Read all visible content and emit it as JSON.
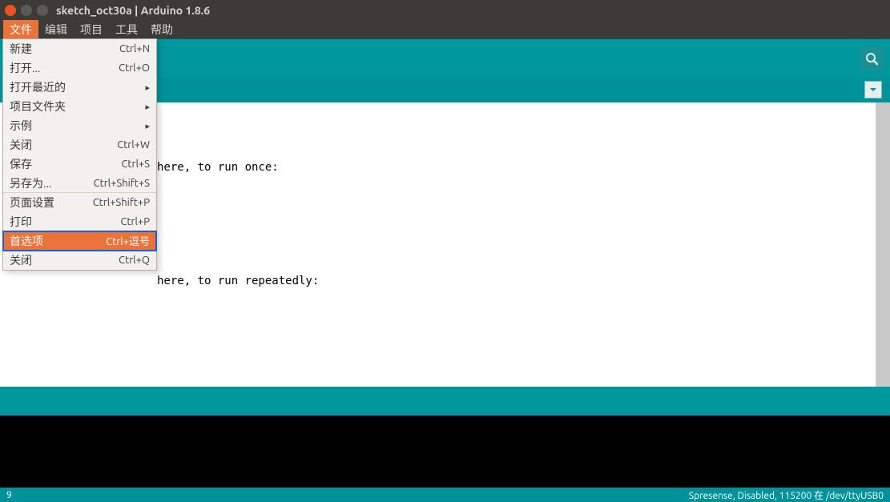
{
  "window": {
    "title": "sketch_oct30a | Arduino 1.8.6"
  },
  "menubar": {
    "items": [
      {
        "label": "文件",
        "active": true
      },
      {
        "label": "编辑"
      },
      {
        "label": "项目"
      },
      {
        "label": "工具"
      },
      {
        "label": "帮助"
      }
    ]
  },
  "dropdown": {
    "items": [
      {
        "label": "新建",
        "shortcut": "Ctrl+N"
      },
      {
        "label": "打开...",
        "shortcut": "Ctrl+O"
      },
      {
        "label": "打开最近的",
        "submenu": true
      },
      {
        "label": "项目文件夹",
        "submenu": true
      },
      {
        "label": "示例",
        "submenu": true
      },
      {
        "label": "关闭",
        "shortcut": "Ctrl+W"
      },
      {
        "label": "保存",
        "shortcut": "Ctrl+S"
      },
      {
        "label": "另存为...",
        "shortcut": "Ctrl+Shift+S",
        "sep": true
      },
      {
        "label": "页面设置",
        "shortcut": "Ctrl+Shift+P"
      },
      {
        "label": "打印",
        "shortcut": "Ctrl+P",
        "sep": true
      },
      {
        "label": "首选项",
        "shortcut": "Ctrl+逗号",
        "hl": true,
        "sep": true
      },
      {
        "label": "关闭",
        "shortcut": "Ctrl+Q"
      }
    ]
  },
  "editor": {
    "line1": "here, to run once:",
    "line2": "here, to run repeatedly:"
  },
  "footer": {
    "left": "9",
    "right": "Spresense, Disabled, 115200 在 /dev/ttyUSB0"
  },
  "icons": {
    "serial_monitor": "serial-monitor-icon",
    "tab_dropdown": "chevron-down-icon"
  }
}
